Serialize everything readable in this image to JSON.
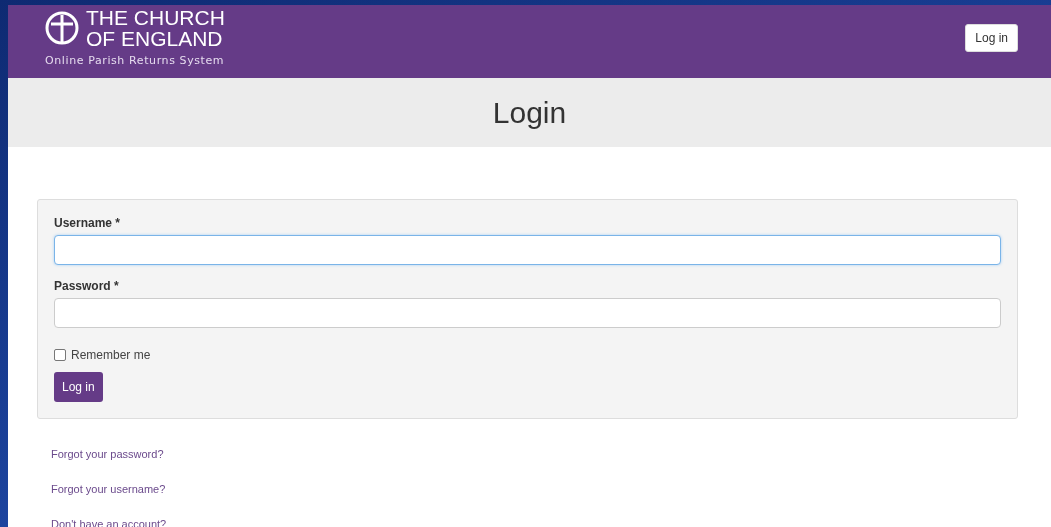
{
  "header": {
    "logo_line_1": "THE CHURCH",
    "logo_line_2": "OF ENGLAND",
    "subtitle": "Online Parish Returns System",
    "login_button": "Log in"
  },
  "page_title": "Login",
  "form": {
    "fields": [
      {
        "label": "Username *",
        "focused": true
      },
      {
        "label": "Password *",
        "focused": false
      }
    ],
    "remember": {
      "label": "Remember me",
      "checked": false
    },
    "submit": "Log in"
  },
  "links": [
    "Forgot your password?",
    "Forgot your username?",
    "Don't have an account?"
  ]
}
